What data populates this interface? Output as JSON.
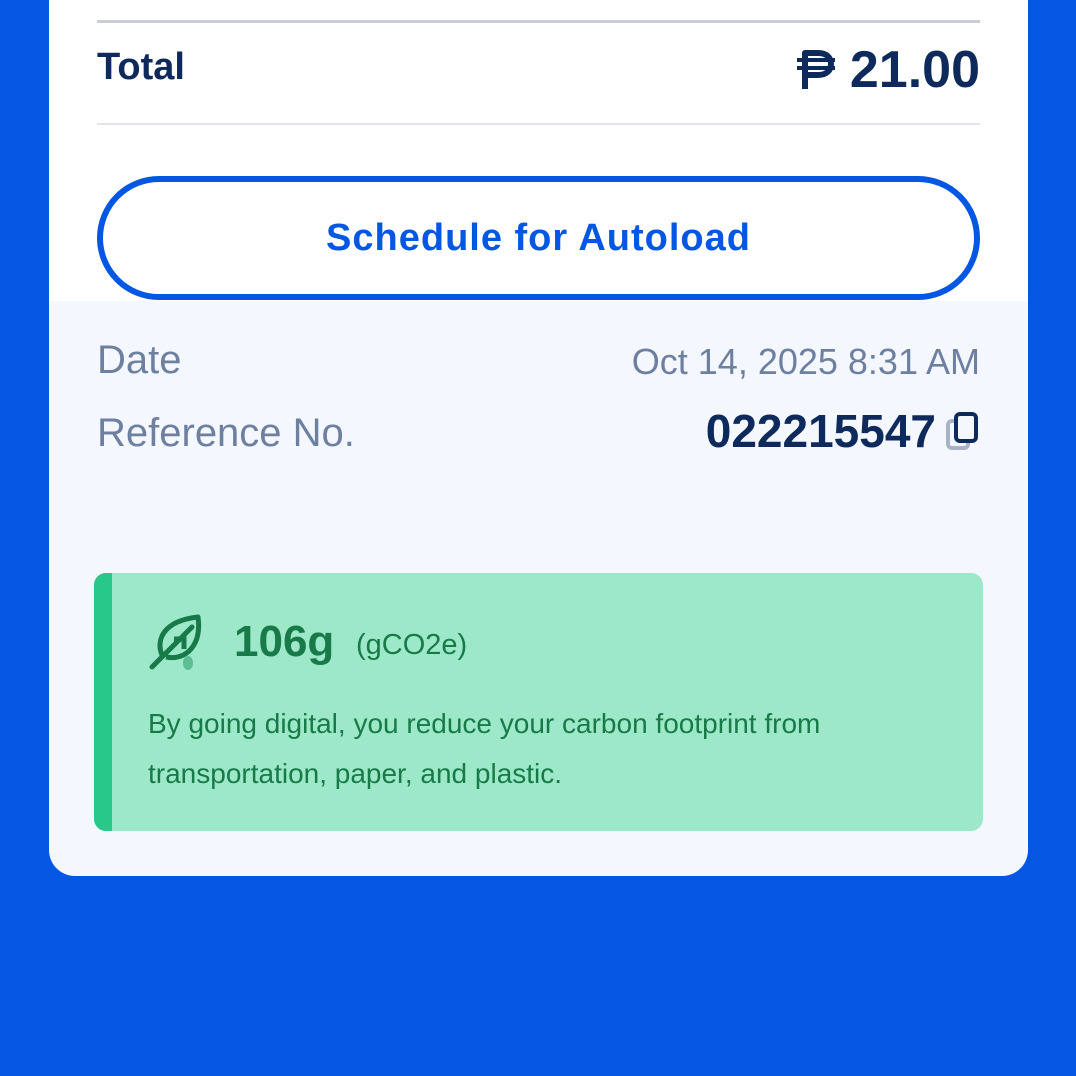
{
  "summary": {
    "total_label": "Total",
    "total_value": "21.00",
    "currency_icon": "peso-sign-icon"
  },
  "actions": {
    "schedule_autoload_label": "Schedule for Autoload"
  },
  "details": {
    "date_label": "Date",
    "date_value": "Oct 14, 2025 8:31 AM",
    "reference_label": "Reference No.",
    "reference_value": "022215547",
    "copy_icon": "copy-icon"
  },
  "eco": {
    "icon": "leaf-icon",
    "amount": "106g",
    "unit": "(gCO2e)",
    "message": "By going digital, you reduce your carbon footprint from transportation, paper, and plastic."
  },
  "colors": {
    "background": "#0357E3",
    "primary_text": "#0E2A5C",
    "secondary_text": "#6E80A0",
    "eco_background": "#9DE8C9",
    "eco_accent": "#28C78A",
    "eco_text": "#187A49"
  }
}
